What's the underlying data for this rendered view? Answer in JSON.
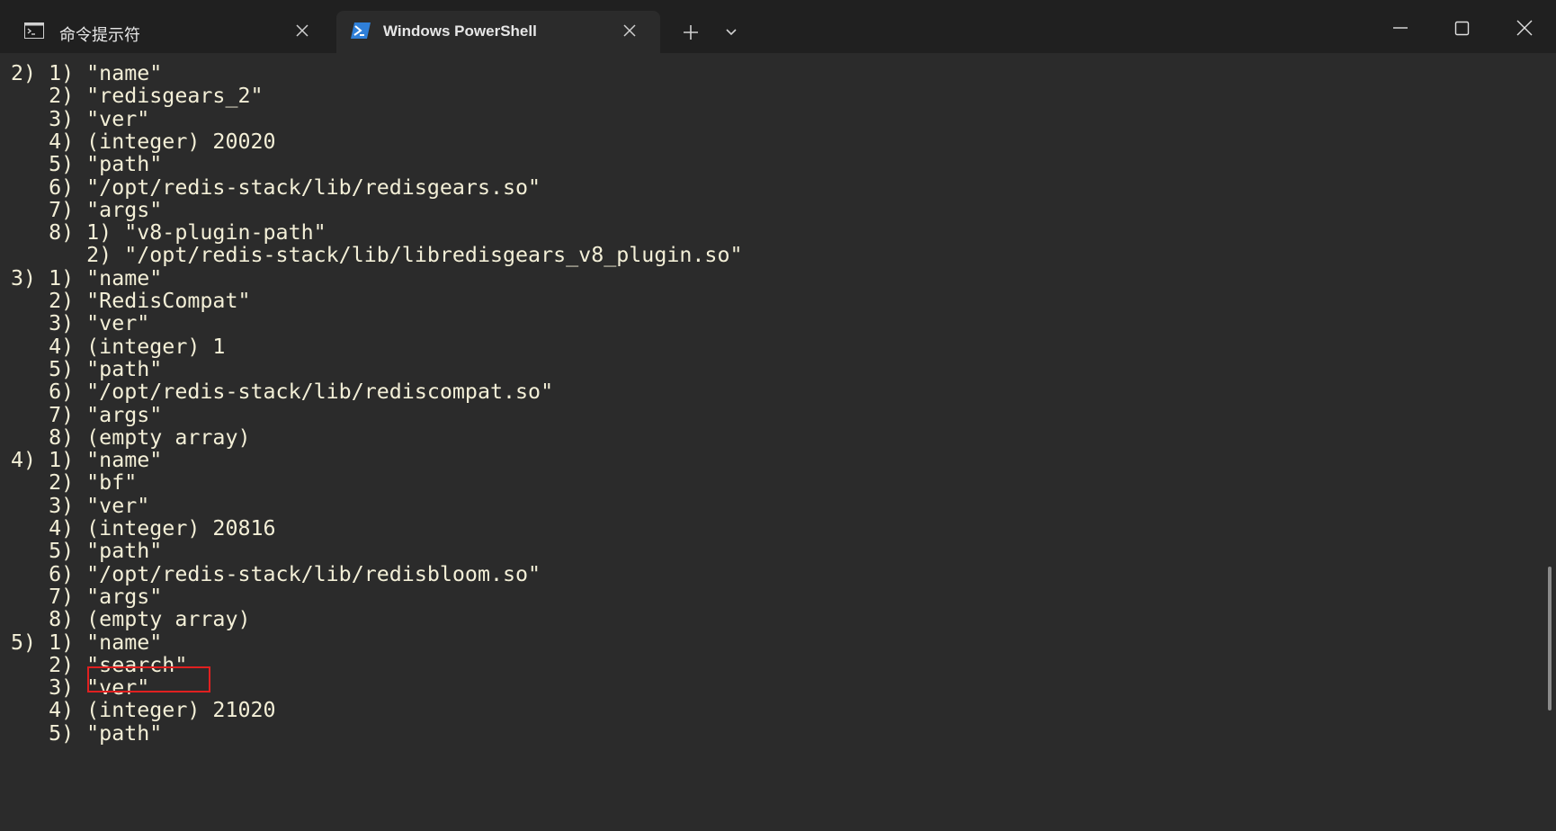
{
  "tabs": [
    {
      "label": "命令提示符",
      "icon": "cmd-icon",
      "active": false
    },
    {
      "label": "Windows PowerShell",
      "icon": "powershell-icon",
      "active": true
    }
  ],
  "titlebar": {
    "new_tab_icon": "plus-icon",
    "dropdown_icon": "chevron-down-icon",
    "window_controls": [
      "minimize-icon",
      "maximize-icon",
      "close-icon"
    ]
  },
  "terminal": {
    "lines": [
      "2) 1) \"name\"",
      "   2) \"redisgears_2\"",
      "   3) \"ver\"",
      "   4) (integer) 20020",
      "   5) \"path\"",
      "   6) \"/opt/redis-stack/lib/redisgears.so\"",
      "   7) \"args\"",
      "   8) 1) \"v8-plugin-path\"",
      "      2) \"/opt/redis-stack/lib/libredisgears_v8_plugin.so\"",
      "3) 1) \"name\"",
      "   2) \"RedisCompat\"",
      "   3) \"ver\"",
      "   4) (integer) 1",
      "   5) \"path\"",
      "   6) \"/opt/redis-stack/lib/rediscompat.so\"",
      "   7) \"args\"",
      "   8) (empty array)",
      "4) 1) \"name\"",
      "   2) \"bf\"",
      "   3) \"ver\"",
      "   4) (integer) 20816",
      "   5) \"path\"",
      "   6) \"/opt/redis-stack/lib/redisbloom.so\"",
      "   7) \"args\"",
      "   8) (empty array)",
      "5) 1) \"name\"",
      "   2) \"search\"",
      "   3) \"ver\"",
      "   4) (integer) 21020",
      "   5) \"path\""
    ]
  },
  "colors": {
    "titlebar_bg": "#202020",
    "terminal_bg": "#2b2b2b",
    "terminal_fg": "#f3efd7",
    "highlight_border": "#e02020"
  }
}
